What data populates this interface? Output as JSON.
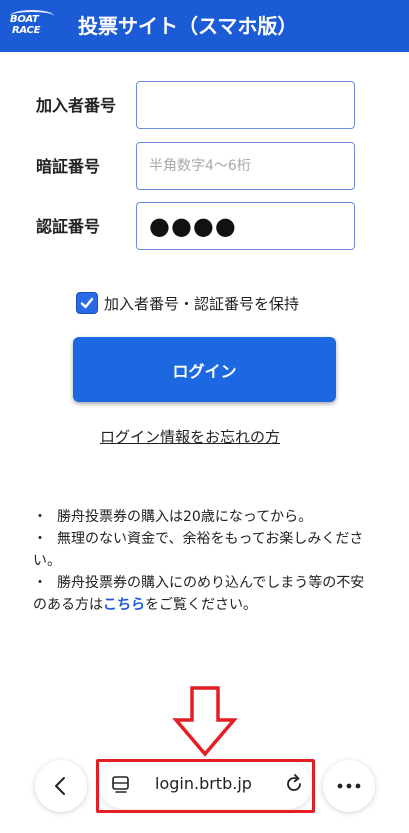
{
  "header": {
    "logo_line1": "BOAT",
    "logo_line2": "RACE",
    "title": "投票サイト（スマホ版）",
    "background_color": "#1c5bd6"
  },
  "form": {
    "subscriber_number": {
      "label": "加入者番号",
      "value": "",
      "placeholder": ""
    },
    "pin_number": {
      "label": "暗証番号",
      "value": "",
      "placeholder": "半角数字4〜6桁"
    },
    "auth_number": {
      "label": "認証番号",
      "masked_value": "●●●●"
    }
  },
  "remember": {
    "checked": true,
    "label": "加入者番号・認証番号を保持"
  },
  "login_button": {
    "label": "ログイン",
    "color": "#1c68e0"
  },
  "forgot_link": {
    "label": "ログイン情報をお忘れの方"
  },
  "notices": [
    {
      "bullet": "・",
      "text": "勝舟投票券の購入は20歳になってから。"
    },
    {
      "bullet": "・",
      "text": "無理のない資金で、余裕をもってお楽しみください。"
    },
    {
      "bullet": "・",
      "text_before": "勝舟投票券の購入にのめり込んでしまう等の不安のある方は",
      "link": "こちら",
      "text_after": "をご覧ください。"
    }
  ],
  "annotation": {
    "color": "#e31e24"
  },
  "browser_bar": {
    "url": "login.brtb.jp",
    "back_icon": "chevron-left-icon",
    "tabs_icon": "tab-list-icon",
    "reload_icon": "reload-icon",
    "more_icon": "more-horizontal-icon"
  }
}
